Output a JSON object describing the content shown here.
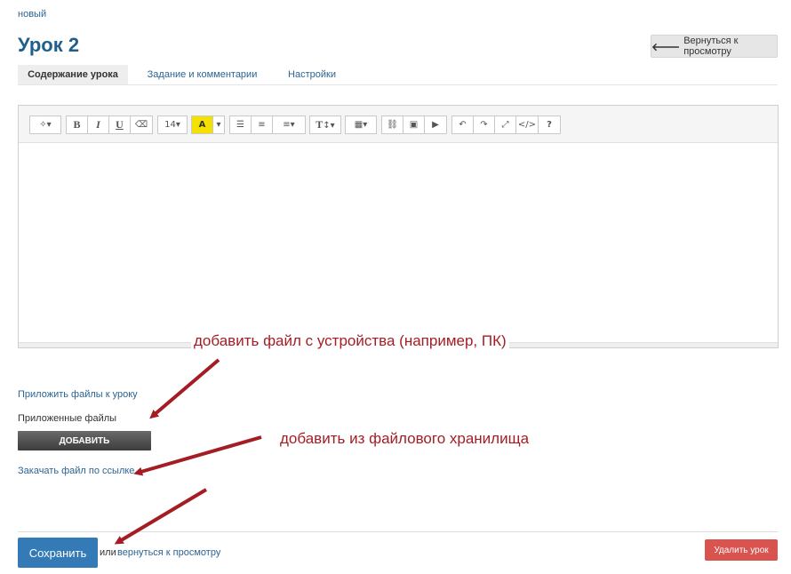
{
  "breadcrumb": "новый",
  "page_title": "Урок 2",
  "back_button": {
    "label": "Вернуться к просмотру"
  },
  "tabs": [
    {
      "label": "Содержание урока",
      "active": true
    },
    {
      "label": "Задание и комментарии",
      "active": false
    },
    {
      "label": "Настройки",
      "active": false
    }
  ],
  "toolbar": {
    "magic": "magic-wand-icon",
    "bold": "B",
    "italic": "I",
    "underline": "U",
    "eraser": "eraser-icon",
    "font_size": "14",
    "highlight": "A",
    "text_height": "T",
    "help": "?"
  },
  "annotations": {
    "from_device": "добавить файл с устройства (например, ПК)",
    "from_storage": "добавить из файлового хранилища"
  },
  "files": {
    "attach_link": "Приложить файлы к уроку",
    "attached_label": "Приложенные файлы",
    "add_button": "ДОБАВИТЬ",
    "url_link": "Закачать файл по ссылке"
  },
  "footer": {
    "save": "Сохранить",
    "or": "или",
    "back_link": "вернуться к просмотру",
    "delete": "Удалить урок"
  },
  "colors": {
    "accent": "#337ab7",
    "title": "#1f5f8b",
    "danger": "#d9534f",
    "annotation": "#a51d24",
    "highlight": "#f4e100"
  }
}
